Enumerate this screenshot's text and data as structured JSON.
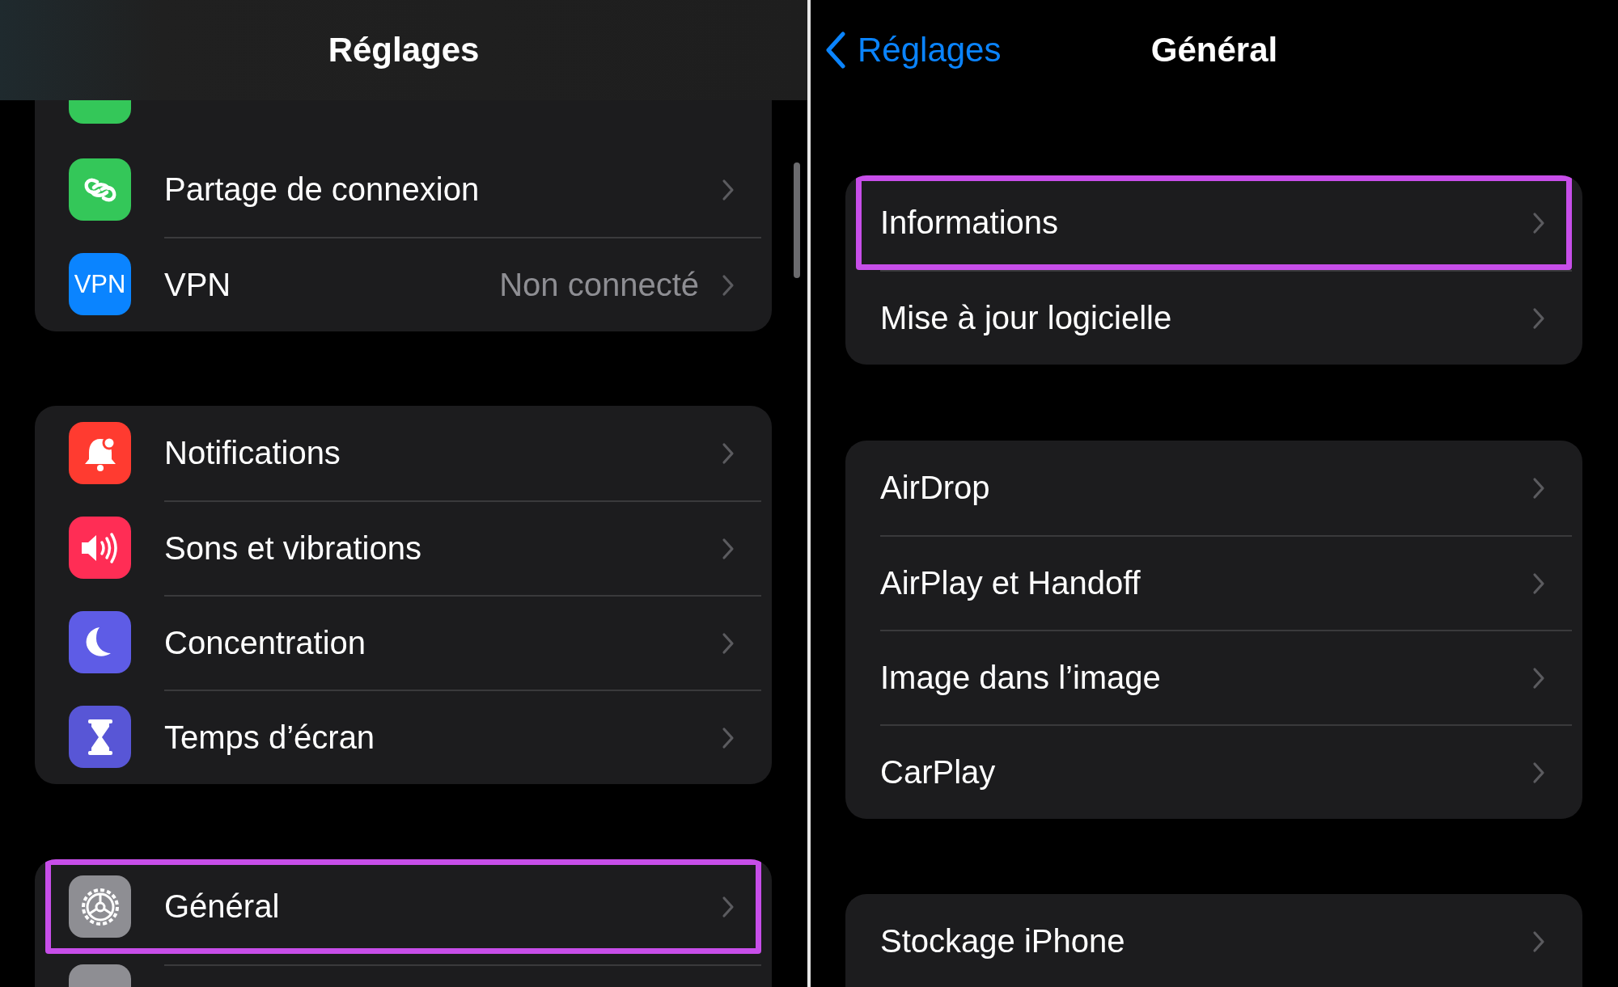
{
  "left": {
    "title": "Réglages",
    "groups": [
      {
        "items": [
          {
            "kind": "partial",
            "color": "#34c759"
          },
          {
            "kind": "row",
            "color": "#34c759",
            "label": "Partage de connexion",
            "highlighted": false
          },
          {
            "kind": "row",
            "color": "#0a84ff",
            "icon_text": "VPN",
            "label": "VPN",
            "value": "Non connecté",
            "highlighted": false
          }
        ]
      },
      {
        "items": [
          {
            "kind": "row",
            "color": "#ff3b30",
            "label": "Notifications",
            "highlighted": false
          },
          {
            "kind": "row",
            "color": "#ff2d55",
            "label": "Sons et vibrations",
            "highlighted": false
          },
          {
            "kind": "row",
            "color": "#5e5ce6",
            "label": "Concentration",
            "highlighted": false
          },
          {
            "kind": "row",
            "color": "#5856d6",
            "label": "Temps d’écran",
            "highlighted": false
          }
        ]
      },
      {
        "items": [
          {
            "kind": "row",
            "color": "#8e8e93",
            "label": "Général",
            "highlighted": true
          },
          {
            "kind": "partial_bottom",
            "color": "#8e8e93"
          }
        ]
      }
    ]
  },
  "right": {
    "back": "Réglages",
    "title": "Général",
    "groups": [
      {
        "items": [
          {
            "kind": "row",
            "label": "Informations",
            "highlighted": true
          },
          {
            "kind": "row",
            "label": "Mise à jour logicielle",
            "highlighted": false
          }
        ]
      },
      {
        "items": [
          {
            "kind": "row",
            "label": "AirDrop",
            "highlighted": false
          },
          {
            "kind": "row",
            "label": "AirPlay et Handoff",
            "highlighted": false
          },
          {
            "kind": "row",
            "label": "Image dans l’image",
            "highlighted": false
          },
          {
            "kind": "row",
            "label": "CarPlay",
            "highlighted": false
          }
        ]
      },
      {
        "items": [
          {
            "kind": "row",
            "label": "Stockage iPhone",
            "highlighted": false
          }
        ]
      }
    ]
  }
}
